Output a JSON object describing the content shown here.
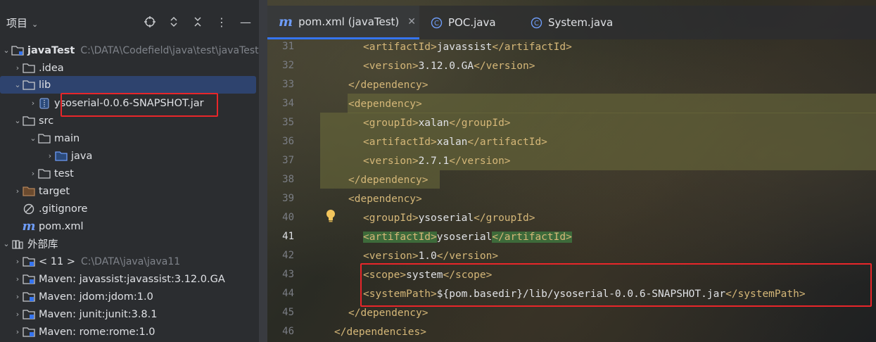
{
  "project_panel": {
    "title": "项目",
    "tree": [
      {
        "label": "javaTest",
        "sub": "C:\\DATA\\Codefield\\java\\test\\javaTest",
        "icon": "module-folder-icon"
      },
      {
        "label": ".idea",
        "icon": "folder-icon"
      },
      {
        "label": "lib",
        "icon": "folder-icon"
      },
      {
        "label": "ysoserial-0.0.6-SNAPSHOT.jar",
        "icon": "jar-icon"
      },
      {
        "label": "src",
        "icon": "folder-icon"
      },
      {
        "label": "main",
        "icon": "folder-icon"
      },
      {
        "label": "java",
        "icon": "source-folder-icon"
      },
      {
        "label": "test",
        "icon": "folder-icon"
      },
      {
        "label": "target",
        "icon": "excluded-folder-icon"
      },
      {
        "label": ".gitignore",
        "icon": "ignore-file-icon"
      },
      {
        "label": "pom.xml",
        "icon": "maven-icon"
      },
      {
        "label": "外部库",
        "icon": "library-icon"
      },
      {
        "label": "< 11 >",
        "sub": "C:\\DATA\\java\\java11",
        "icon": "jdk-folder-icon"
      },
      {
        "label": "Maven: javassist:javassist:3.12.0.GA",
        "icon": "maven-library-icon"
      },
      {
        "label": "Maven: jdom:jdom:1.0",
        "icon": "maven-library-icon"
      },
      {
        "label": "Maven: junit:junit:3.8.1",
        "icon": "maven-library-icon"
      },
      {
        "label": "Maven: rome:rome:1.0",
        "icon": "maven-library-icon"
      }
    ]
  },
  "editor": {
    "tabs": [
      {
        "label": "pom.xml (javaTest)",
        "icon": "maven-icon",
        "active": true
      },
      {
        "label": "POC.java",
        "icon": "class-icon"
      },
      {
        "label": "System.java",
        "icon": "class-icon"
      }
    ],
    "current_line": "41",
    "lines": [
      {
        "num": "31",
        "indent": "      ",
        "open": "<artifactId>",
        "text": "javassist",
        "close": "</artifactId>"
      },
      {
        "num": "32",
        "indent": "      ",
        "open": "<version>",
        "text": "3.12.0.GA",
        "close": "</version>"
      },
      {
        "num": "33",
        "indent": "    ",
        "open": "</dependency>",
        "text": "",
        "close": ""
      },
      {
        "num": "34",
        "indent": "    ",
        "open": "<dependency>",
        "text": "",
        "close": ""
      },
      {
        "num": "35",
        "indent": "      ",
        "open": "<groupId>",
        "text": "xalan",
        "close": "</groupId>"
      },
      {
        "num": "36",
        "indent": "      ",
        "open": "<artifactId>",
        "text": "xalan",
        "close": "</artifactId>"
      },
      {
        "num": "37",
        "indent": "      ",
        "open": "<version>",
        "text": "2.7.1",
        "close": "</version>"
      },
      {
        "num": "38",
        "indent": "    ",
        "open": "</dependency>",
        "text": "",
        "close": ""
      },
      {
        "num": "39",
        "indent": "    ",
        "open": "<dependency>",
        "text": "",
        "close": ""
      },
      {
        "num": "40",
        "indent": "      ",
        "open": "<groupId>",
        "text": "ysoserial",
        "close": "</groupId>"
      },
      {
        "num": "41",
        "indent": "      ",
        "open": "<artifactId>",
        "text": "ysoserial",
        "close": "</artifactId>"
      },
      {
        "num": "42",
        "indent": "      ",
        "open": "<version>",
        "text": "1.0",
        "close": "</version>"
      },
      {
        "num": "43",
        "indent": "      ",
        "open": "<scope>",
        "text": "system",
        "close": "</scope>"
      },
      {
        "num": "44",
        "indent": "      ",
        "open": "<systemPath>",
        "text": "${pom.basedir}/lib/ysoserial-0.0.6-SNAPSHOT.jar",
        "close": "</systemPath>"
      },
      {
        "num": "45",
        "indent": "    ",
        "open": "</dependency>",
        "text": "",
        "close": ""
      },
      {
        "num": "46",
        "indent": "  ",
        "open": "</dependencies>",
        "text": "",
        "close": ""
      }
    ]
  },
  "colors": {
    "accent": "#3574f0",
    "annotation_box": "#e8262a",
    "xml_tag": "#d5b778",
    "selection": "#2e436e"
  }
}
